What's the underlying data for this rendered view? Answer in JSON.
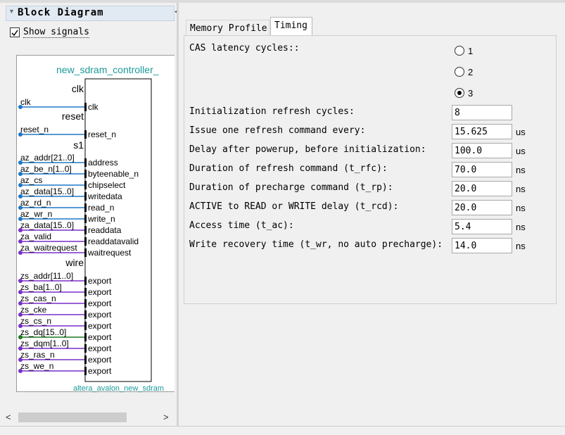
{
  "left_panel": {
    "title": "Block Diagram",
    "show_signals": {
      "label": "Show signals",
      "checked": true
    },
    "component": {
      "instance_name": "new_sdram_controller_",
      "type_name": "altera_avalon_new_sdram",
      "interfaces": [
        "clk",
        "reset",
        "s1",
        "wire"
      ],
      "ports": [
        {
          "outer": "clk",
          "inner": "clk",
          "color": "#1e78c8"
        },
        {
          "outer": "reset_n",
          "inner": "reset_n",
          "color": "#1e78c8"
        },
        {
          "outer": "az_addr[21..0]",
          "inner": "address",
          "color": "#1e78c8"
        },
        {
          "outer": "az_be_n[1..0]",
          "inner": "byteenable_n",
          "color": "#1e78c8"
        },
        {
          "outer": "az_cs",
          "inner": "chipselect",
          "color": "#1e78c8"
        },
        {
          "outer": "az_data[15..0]",
          "inner": "writedata",
          "color": "#1e78c8"
        },
        {
          "outer": "az_rd_n",
          "inner": "read_n",
          "color": "#1e78c8"
        },
        {
          "outer": "az_wr_n",
          "inner": "write_n",
          "color": "#1e78c8"
        },
        {
          "outer": "za_data[15..0]",
          "inner": "readdata",
          "color": "#7a2fc8"
        },
        {
          "outer": "za_valid",
          "inner": "readdatavalid",
          "color": "#7a2fc8"
        },
        {
          "outer": "za_waitrequest",
          "inner": "waitrequest",
          "color": "#7a2fc8"
        },
        {
          "outer": "zs_addr[11..0]",
          "inner": "export",
          "color": "#7a2fc8"
        },
        {
          "outer": "zs_ba[1..0]",
          "inner": "export",
          "color": "#7a2fc8"
        },
        {
          "outer": "zs_cas_n",
          "inner": "export",
          "color": "#7a2fc8"
        },
        {
          "outer": "zs_cke",
          "inner": "export",
          "color": "#7a2fc8"
        },
        {
          "outer": "zs_cs_n",
          "inner": "export",
          "color": "#7a2fc8"
        },
        {
          "outer": "zs_dq[15..0]",
          "inner": "export",
          "color": "#1f7a1f"
        },
        {
          "outer": "zs_dqm[1..0]",
          "inner": "export",
          "color": "#7a2fc8"
        },
        {
          "outer": "zs_ras_n",
          "inner": "export",
          "color": "#7a2fc8"
        },
        {
          "outer": "zs_we_n",
          "inner": "export",
          "color": "#7a2fc8"
        }
      ]
    }
  },
  "tabs": [
    {
      "label": "Memory Profile",
      "active": false
    },
    {
      "label": "Timing",
      "active": true
    }
  ],
  "timing": {
    "cas_latency": {
      "label": "CAS latency cycles::",
      "options": [
        "1",
        "2",
        "3"
      ],
      "selected": "3"
    },
    "fields": [
      {
        "label": "Initialization refresh cycles:",
        "value": "8",
        "unit": ""
      },
      {
        "label": "Issue one refresh command every:",
        "value": "15.625",
        "unit": "us"
      },
      {
        "label": "Delay after powerup, before initialization:",
        "value": "100.0",
        "unit": "us"
      },
      {
        "label": "Duration of refresh command (t_rfc):",
        "value": "70.0",
        "unit": "ns"
      },
      {
        "label": "Duration of precharge command (t_rp):",
        "value": "20.0",
        "unit": "ns"
      },
      {
        "label": "ACTIVE to READ or WRITE delay (t_rcd):",
        "value": "20.0",
        "unit": "ns"
      },
      {
        "label": "Access time (t_ac):",
        "value": "5.4",
        "unit": "ns"
      },
      {
        "label": "Write recovery time (t_wr, no auto precharge):",
        "value": "14.0",
        "unit": "ns"
      }
    ]
  },
  "colors": {
    "accent_teal": "#1a9a9a",
    "signal_blue": "#1e78c8",
    "signal_purple": "#7a2fc8",
    "signal_green": "#1f7a1f"
  }
}
